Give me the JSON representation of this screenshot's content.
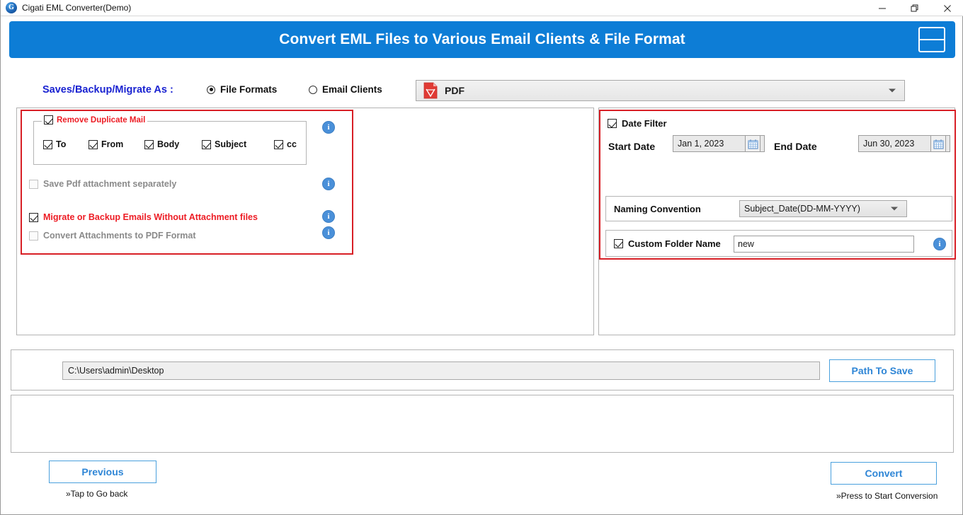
{
  "window": {
    "title": "Cigati EML Converter(Demo)",
    "app_icon": "cigati-logo-icon",
    "controls": {
      "minimize": "minimize-icon",
      "maximize": "restore-icon",
      "close": "close-icon"
    }
  },
  "banner": {
    "title": "Convert EML Files to Various Email Clients & File Format",
    "menu_icon": "hamburger-menu-icon",
    "background": "#0d7dd6"
  },
  "options_row": {
    "section_label": "Saves/Backup/Migrate As :",
    "radios": [
      {
        "label": "File Formats",
        "selected": true
      },
      {
        "label": "Email Clients",
        "selected": false
      }
    ],
    "format_select": {
      "value": "PDF",
      "icon": "pdf-file-icon"
    }
  },
  "left_panel": {
    "duplicate_group": {
      "title": "Remove Duplicate Mail",
      "checked": true,
      "fields": [
        {
          "label": "To",
          "checked": true
        },
        {
          "label": "From",
          "checked": true
        },
        {
          "label": "Body",
          "checked": true
        },
        {
          "label": "Subject",
          "checked": true
        },
        {
          "label": "cc",
          "checked": true
        }
      ]
    },
    "options": [
      {
        "label": "Save Pdf attachment separately",
        "checked": false,
        "enabled": false
      },
      {
        "label": "Migrate or Backup Emails Without Attachment files",
        "checked": true,
        "enabled": true
      },
      {
        "label": "Convert Attachments to PDF Format",
        "checked": false,
        "enabled": false
      }
    ]
  },
  "right_panel": {
    "date_filter": {
      "label": "Date Filter",
      "checked": true,
      "start_label": "Start Date",
      "start_value": "Jan 1, 2023",
      "end_label": "End Date",
      "end_value": "Jun 30, 2023",
      "calendar_icon": "calendar-icon"
    },
    "naming": {
      "label": "Naming Convention",
      "value": "Subject_Date(DD-MM-YYYY)"
    },
    "custom_folder": {
      "label": "Custom Folder Name",
      "checked": true,
      "value": "new",
      "placeholder": ""
    }
  },
  "path_row": {
    "value": "C:\\Users\\admin\\Desktop",
    "button_label": "Path To Save"
  },
  "footer": {
    "previous_label": "Previous",
    "previous_hint": "»Tap to Go back",
    "convert_label": "Convert",
    "convert_hint": "»Press to Start Conversion"
  },
  "colors": {
    "accent_blue": "#0d7dd6",
    "link_blue": "#2f86d6",
    "alert_red": "#ed1c24",
    "label_blue": "#1a23d1"
  }
}
